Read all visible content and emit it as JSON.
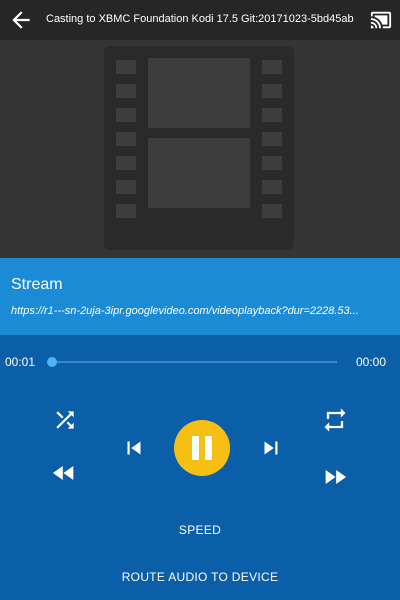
{
  "topbar": {
    "title": "Casting to XBMC Foundation Kodi 17.5 Git:20171023-5bd45ab",
    "back_icon": "arrow-back-icon",
    "cast_icon": "cast-connected-icon"
  },
  "artwork": {
    "icon": "film-placeholder-icon"
  },
  "media": {
    "title": "Stream",
    "url": "https://r1---sn-2uja-3ipr.googlevideo.com/videoplayback?dur=2228.53..."
  },
  "playback": {
    "elapsed": "00:01",
    "duration": "00:00",
    "progress": 0.0,
    "state": "playing"
  },
  "controls": {
    "shuffle_icon": "shuffle-icon",
    "rewind_icon": "rewind-icon",
    "previous_icon": "skip-previous-icon",
    "pause_icon": "pause-icon",
    "next_icon": "skip-next-icon",
    "repeat_icon": "repeat-icon",
    "fast_forward_icon": "fast-forward-icon",
    "speed_label": "SPEED",
    "route_label": "ROUTE AUDIO TO DEVICE"
  },
  "colors": {
    "topbar": "#262626",
    "artwork_bg": "#343434",
    "info_bg": "#1a8bd4",
    "controls_bg": "#0b5ea8",
    "accent": "#4fb2f2",
    "play_button": "#f6bf13"
  }
}
